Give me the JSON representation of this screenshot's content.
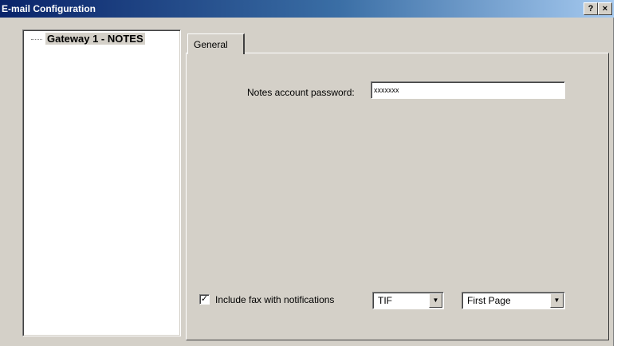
{
  "window": {
    "title": "E-mail Configuration",
    "help_label": "?",
    "close_label": "×"
  },
  "tree": {
    "items": [
      {
        "label": "Gateway 1 - NOTES"
      }
    ]
  },
  "tabs": [
    {
      "label": "General"
    }
  ],
  "general": {
    "password_label": "Notes account password:",
    "password_value": "xxxxxxx",
    "include_fax_label": "Include fax with notifications",
    "include_fax_checked": true,
    "checkbox_mark": "✓",
    "format_value": "TIF",
    "pages_value": "First Page",
    "dropdown_arrow": "▼"
  }
}
